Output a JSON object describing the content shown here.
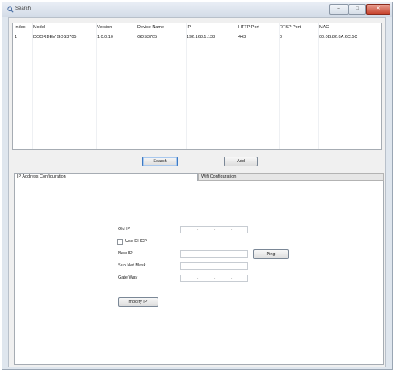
{
  "window": {
    "title": "Search",
    "buttons": {
      "minimize": "–",
      "maximize": "□",
      "close": "✕"
    },
    "icon": "magnifier-icon"
  },
  "device_table": {
    "columns": [
      "Index",
      "Model",
      "Version",
      "Device Name",
      "IP",
      "HTTP Port",
      "RTSP Port",
      "MAC"
    ],
    "rows": [
      [
        "1",
        "DOORDEV GDS3705",
        "1.0.0.10",
        "GDS3705",
        "192.168.1.138",
        "443",
        "0",
        "00:0B:82:8A:6C:5C"
      ]
    ]
  },
  "actions": {
    "search_label": "Search",
    "add_label": "Add"
  },
  "tabs": {
    "ip_config": "IP Address Configuration",
    "wifi_config": "Wifi Configuration"
  },
  "ip_form": {
    "old_ip_label": "Old IP",
    "use_dhcp_label": "Use DHCP",
    "new_ip_label": "New IP",
    "subnet_mask_label": "Sub Net Mask",
    "gateway_label": "Gate Way",
    "ping_label": "Ping",
    "modify_ip_label": "modify IP",
    "ip_dot": "."
  }
}
